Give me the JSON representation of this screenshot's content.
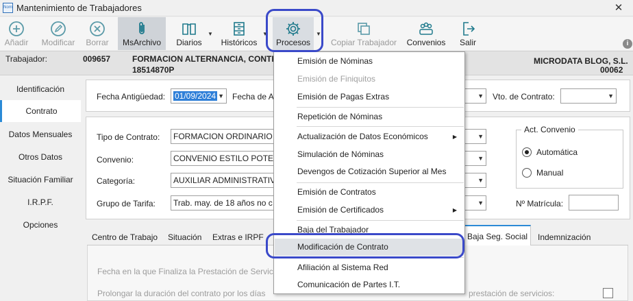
{
  "window": {
    "app_icon_text": "Nom",
    "title": "Mantenimiento de Trabajadores",
    "close_symbol": "✕"
  },
  "toolbar": {
    "buttons": [
      {
        "label": "Añadir",
        "icon": "add-circle-icon",
        "disabled": true
      },
      {
        "label": "Modificar",
        "icon": "pencil-icon",
        "disabled": true
      },
      {
        "label": "Borrar",
        "icon": "delete-circle-icon",
        "disabled": true
      },
      {
        "label": "MsArchivo",
        "icon": "paperclip-icon",
        "disabled": false
      },
      {
        "label": "Diarios",
        "icon": "book-icon",
        "disabled": false
      },
      {
        "label": "Históricos",
        "icon": "cabinet-icon",
        "disabled": false
      },
      {
        "label": "Procesos",
        "icon": "gear-icon",
        "disabled": false
      },
      {
        "label": "Copiar Trabajador",
        "icon": "copy-icon",
        "disabled": true
      },
      {
        "label": "Convenios",
        "icon": "group-icon",
        "disabled": false
      },
      {
        "label": "Salir",
        "icon": "exit-icon",
        "disabled": false
      }
    ],
    "info_symbol": "i"
  },
  "worker": {
    "label": "Trabajador:",
    "code": "009657",
    "name": "FORMACION ALTERNANCIA, CONTRA",
    "id": "18514870P",
    "company": "MICRODATA BLOG, S.L.",
    "company_code": "00062"
  },
  "sidebar": {
    "items": [
      "Identificación",
      "Contrato",
      "Datos Mensuales",
      "Otros Datos",
      "Situación Familiar",
      "I.R.P.F.",
      "Opciones"
    ],
    "selected": "Contrato"
  },
  "form": {
    "fecha_antiguedad_label": "Fecha Antigüedad:",
    "fecha_antiguedad_value": "01/09/2024",
    "fecha_a_label": "Fecha de A",
    "vto_contrato_label": "Vto. de Contrato:",
    "tipo_contrato_label": "Tipo de Contrato:",
    "tipo_contrato_value": "FORMACION ORDINARIO (42",
    "convenio_label": "Convenio:",
    "convenio_value": "CONVENIO ESTILO POTENT",
    "categoria_label": "Categoría:",
    "categoria_value": "AUXILIAR ADMINISTRATIVO",
    "grupo_tarifa_label": "Grupo de Tarifa:",
    "grupo_tarifa_value": "Trab. may. de 18 años no c",
    "act_convenio_title": "Act. Convenio",
    "radio_automatica": "Automática",
    "radio_manual": "Manual",
    "matricula_label": "Nº Matrícula:"
  },
  "tabs": {
    "items": [
      "Centro de Trabajo",
      "Situación",
      "Extras e IRPF"
    ],
    "baja_seg_social": "Baja Seg. Social",
    "indemnizacion": "Indemnización"
  },
  "lower": {
    "fecha_finaliza": "Fecha en la que Finaliza la Prestación de Servic",
    "prolongar_left": "Prolongar la duración del contrato por los días",
    "prolongar_right": "prestación de servicios:"
  },
  "menu": {
    "items": [
      {
        "label": "Emisión de Nóminas",
        "disabled": false,
        "submenu": false
      },
      {
        "label": "Emisión de Finiquitos",
        "disabled": true,
        "submenu": false
      },
      {
        "label": "Emisión de Pagas Extras",
        "disabled": false,
        "submenu": false
      },
      {
        "label": "Repetición de Nóminas",
        "disabled": false,
        "submenu": false
      },
      {
        "label": "Actualización de Datos Económicos",
        "disabled": false,
        "submenu": true
      },
      {
        "label": "Simulación de Nóminas",
        "disabled": false,
        "submenu": false
      },
      {
        "label": "Devengos de Cotización Superior al Mes",
        "disabled": false,
        "submenu": false
      },
      {
        "label": "Emisión de Contratos",
        "disabled": false,
        "submenu": false
      },
      {
        "label": "Emisión de Certificados",
        "disabled": false,
        "submenu": true
      },
      {
        "label": "Baja del Trabajador",
        "disabled": false,
        "submenu": false
      },
      {
        "label": "Modificación de Contrato",
        "disabled": false,
        "submenu": false,
        "highlighted": true
      },
      {
        "label": "Afiliación al Sistema Red",
        "disabled": false,
        "submenu": false
      },
      {
        "label": "Comunicación de Partes I.T.",
        "disabled": false,
        "submenu": false
      }
    ],
    "submenu_arrow": "▶"
  },
  "symbols": {
    "combo_arrow": "▼",
    "caret": "▼"
  },
  "colors": {
    "accent": "#2b8ad6",
    "highlight_outline": "#3a49c9",
    "icon_teal": "#1f7a8c",
    "selection_blue": "#2f7fd8"
  }
}
